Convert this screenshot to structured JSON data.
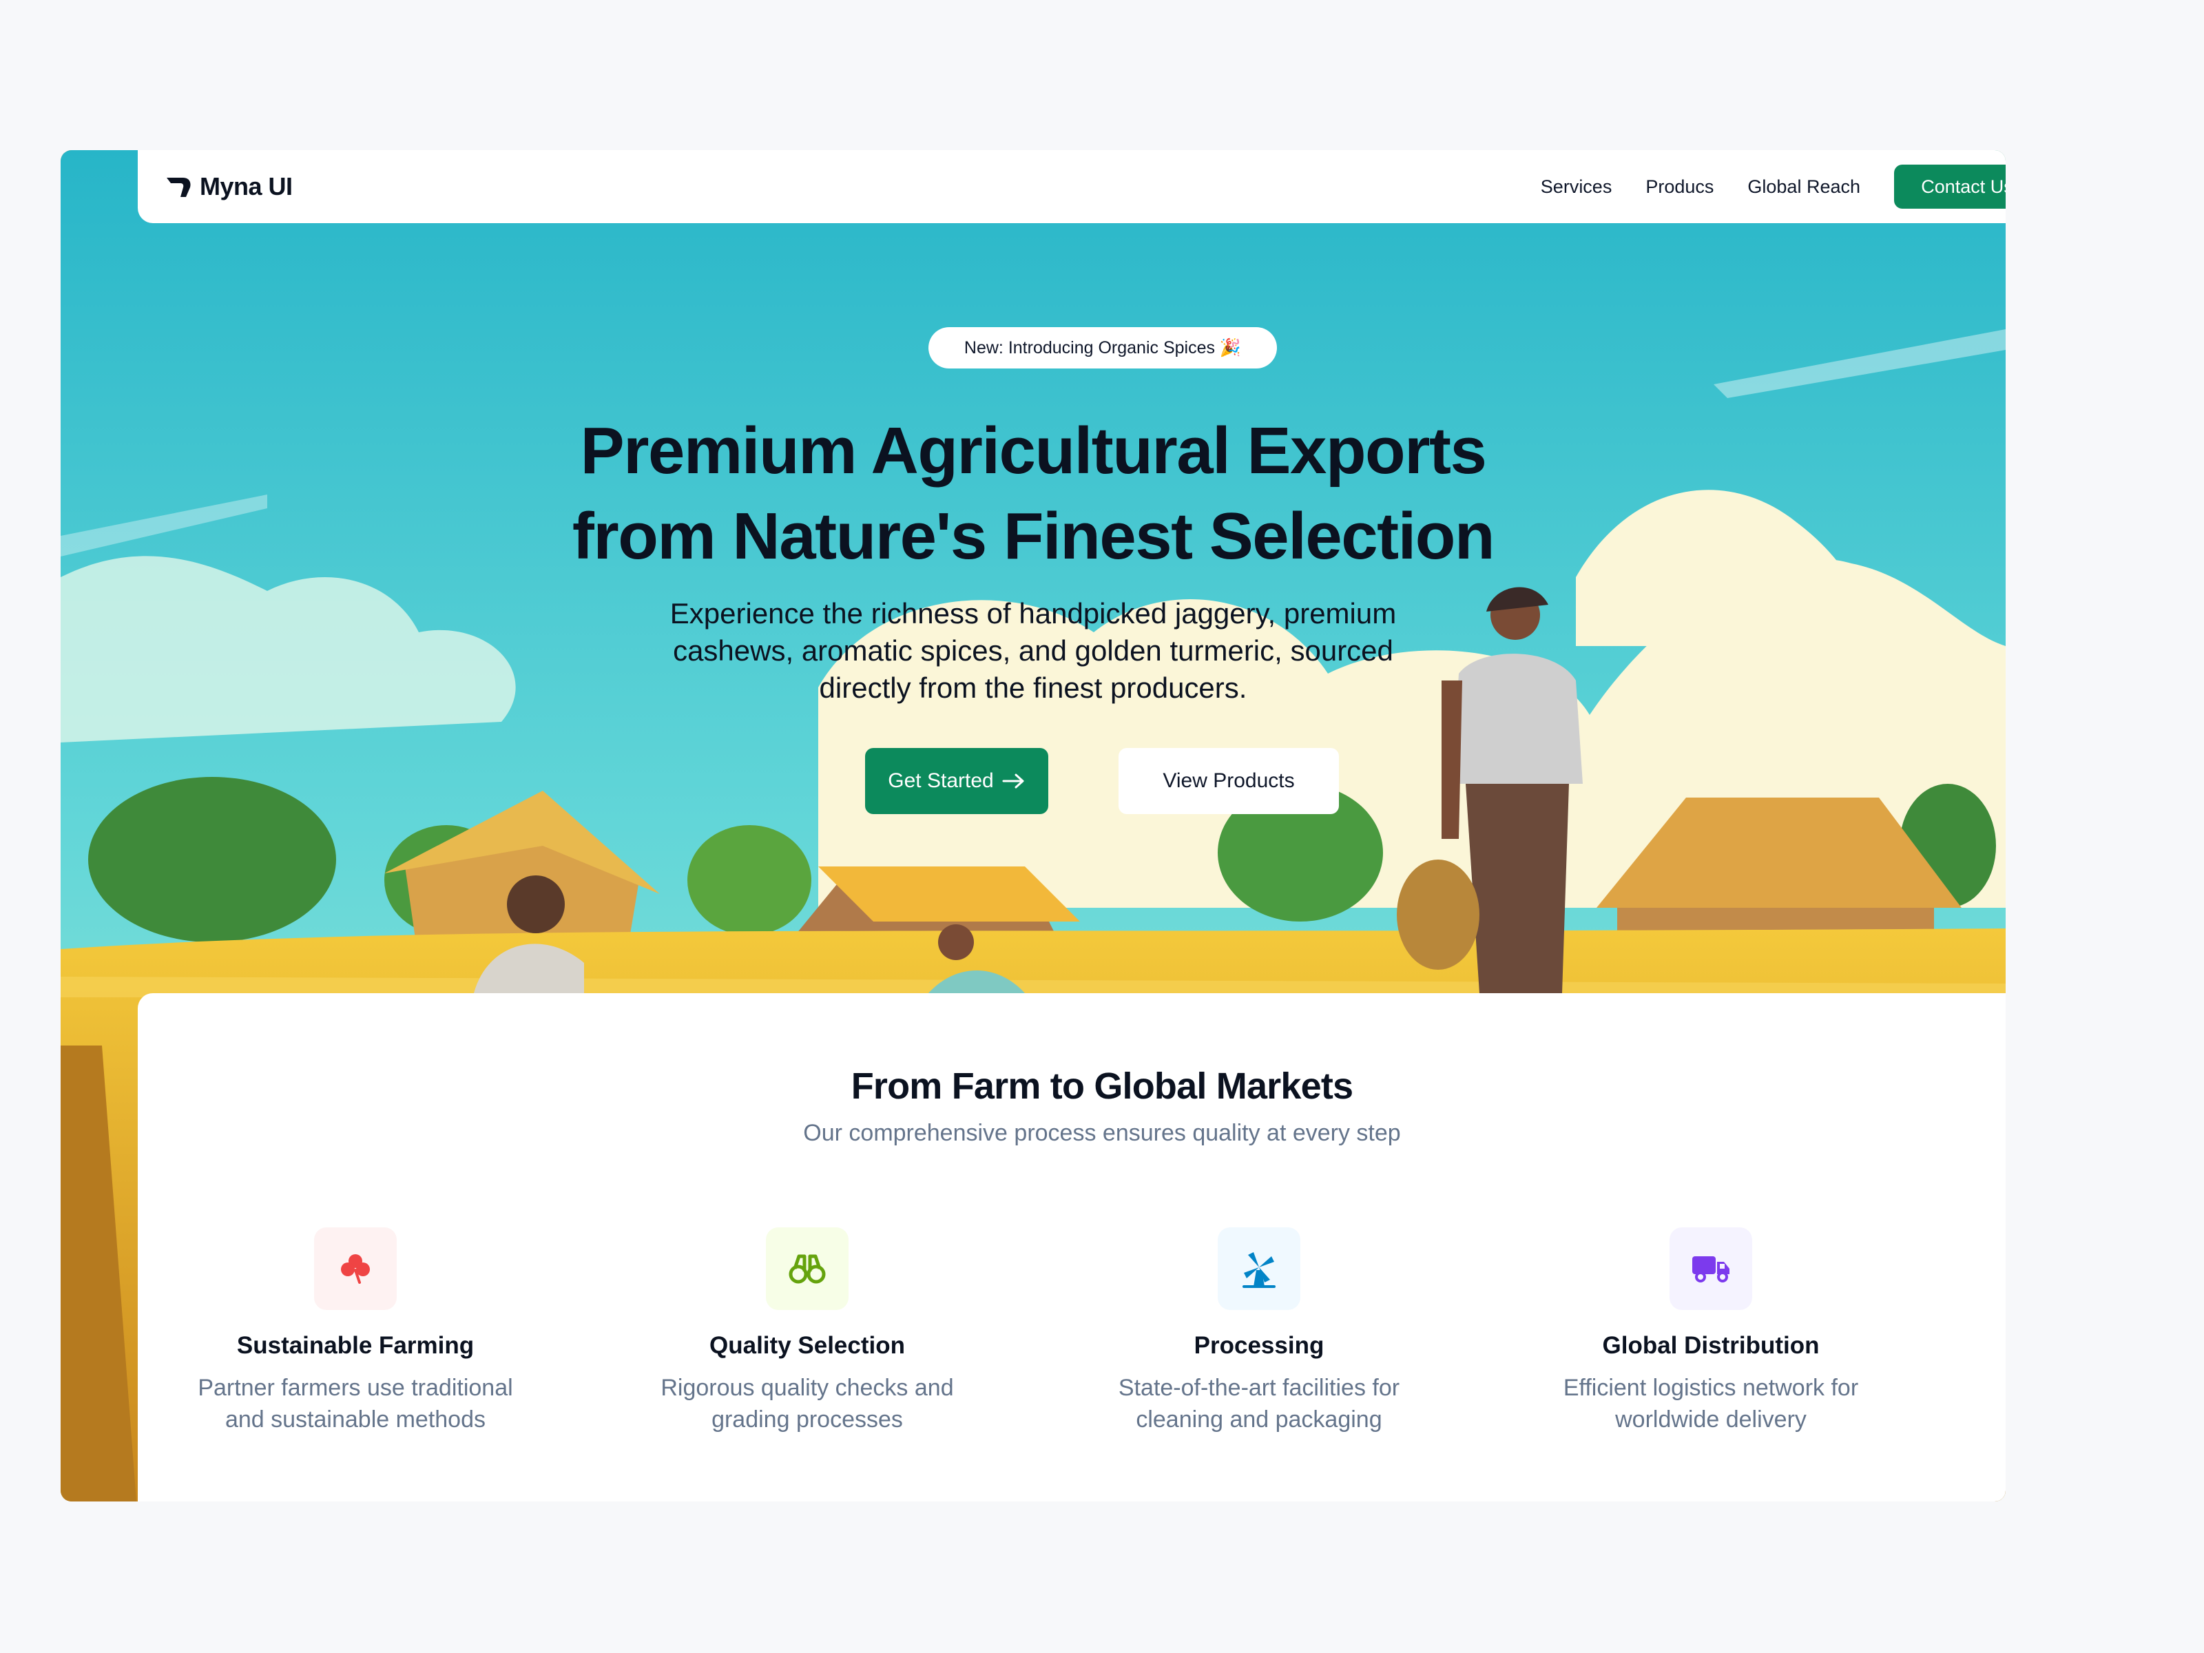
{
  "nav": {
    "brand": "Myna UI",
    "links": [
      "Services",
      "Producs",
      "Global Reach"
    ],
    "cta": "Contact Us"
  },
  "hero": {
    "badge": "New: Introducing Organic Spices 🎉",
    "headline_line1": "Premium Agricultural Exports",
    "headline_line2": "from Nature's Finest Selection",
    "subtext": "Experience the richness of handpicked jaggery, premium cashews, aromatic spices, and golden turmeric, sourced directly from the finest producers.",
    "primary_button": "Get Started",
    "secondary_button": "View Products"
  },
  "process": {
    "title": "From Farm to Global Markets",
    "subtitle": "Our comprehensive process ensures quality at every step",
    "features": [
      {
        "icon": "clover-icon",
        "title": "Sustainable Farming",
        "line1": "Partner farmers use traditional",
        "line2": "and sustainable methods",
        "color": "#ef4444",
        "bg": "#fef2f2"
      },
      {
        "icon": "binoculars-icon",
        "title": "Quality Selection",
        "line1": "Rigorous quality checks and",
        "line2": "grading processes",
        "color": "#65a30d",
        "bg": "#f7fee7"
      },
      {
        "icon": "windmill-icon",
        "title": "Processing",
        "line1": "State-of-the-art facilities for",
        "line2": "cleaning and packaging",
        "color": "#0284c7",
        "bg": "#f0f9ff"
      },
      {
        "icon": "truck-icon",
        "title": "Global Distribution",
        "line1": "Efficient logistics network for",
        "line2": "worldwide delivery",
        "color": "#7c3aed",
        "bg": "#f5f3ff"
      }
    ]
  },
  "colors": {
    "accent": "#0c8a5c",
    "sky": "#3cc6d2",
    "field": "#e2a92a",
    "text_muted": "#64748b"
  }
}
